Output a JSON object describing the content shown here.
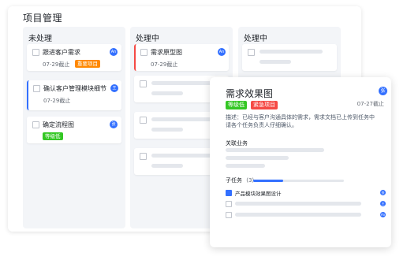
{
  "board": {
    "title": "项目管理"
  },
  "columns": [
    {
      "title": "未处理"
    },
    {
      "title": "处理中"
    },
    {
      "title": "处理中"
    }
  ],
  "cards": {
    "c1": {
      "title": "跟进客户需求",
      "date": "07-29截止",
      "tag": "重要项目",
      "tag_color": "#ff8800",
      "avatar": "An"
    },
    "c2": {
      "title": "确认客户管理模块细节",
      "date": "07-29截止",
      "avatar": "王"
    },
    "c3": {
      "title": "确定流程图",
      "tag": "等级低",
      "tag_color": "#34c724",
      "avatar": "张"
    },
    "c4": {
      "title": "需求原型图",
      "date": "07-29截止",
      "avatar": "An"
    }
  },
  "detail": {
    "title": "需求效果图",
    "avatar": "张",
    "tag1": "等级低",
    "tag1_color": "#34c724",
    "tag2": "紧急项目",
    "tag2_color": "#f54a45",
    "date": "07-27截止",
    "description": "描述：已经与客户沟通具体的需求，需求文档已上传到任务中请各个任务负责人仔细确认。",
    "related_label": "关联业务",
    "subtasks_label": "子任务",
    "subtasks_count": "(3)",
    "subtasks_progress": 0.33,
    "subtasks": [
      {
        "label": "产品模块效果图设计",
        "avatar": "张"
      },
      {
        "label": "",
        "avatar": "王"
      },
      {
        "label": "",
        "avatar": "An"
      }
    ]
  },
  "colors": {
    "primary": "#3370ff",
    "danger": "#f54a45",
    "success": "#34c724",
    "warning": "#ff8800"
  }
}
